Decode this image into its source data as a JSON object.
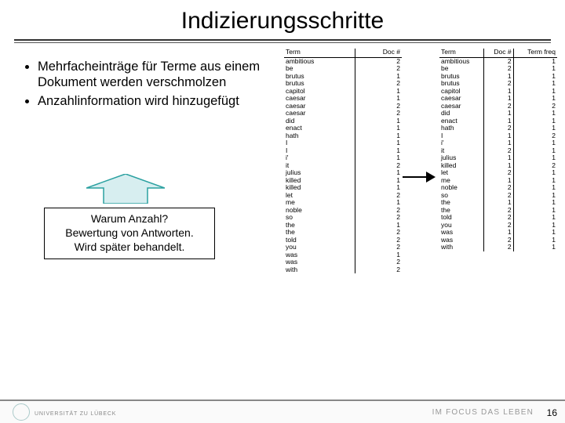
{
  "title": "Indizierungsschritte",
  "bullets": [
    "Mehrfacheinträge für Terme aus einem Dokument werden verschmolzen",
    "Anzahlinformation wird hinzugefügt"
  ],
  "callout": [
    "Warum Anzahl?",
    "Bewertung von Antworten.",
    "Wird später behandelt."
  ],
  "table1": {
    "headers": [
      "Term",
      "Doc #"
    ],
    "rows": [
      [
        "ambitious",
        2
      ],
      [
        "be",
        2
      ],
      [
        "brutus",
        1
      ],
      [
        "brutus",
        2
      ],
      [
        "capitol",
        1
      ],
      [
        "caesar",
        1
      ],
      [
        "caesar",
        2
      ],
      [
        "caesar",
        2
      ],
      [
        "did",
        1
      ],
      [
        "enact",
        1
      ],
      [
        "hath",
        1
      ],
      [
        "I",
        1
      ],
      [
        "I",
        1
      ],
      [
        "i'",
        1
      ],
      [
        "it",
        2
      ],
      [
        "julius",
        1
      ],
      [
        "killed",
        1
      ],
      [
        "killed",
        1
      ],
      [
        "let",
        2
      ],
      [
        "me",
        1
      ],
      [
        "noble",
        2
      ],
      [
        "so",
        2
      ],
      [
        "the",
        1
      ],
      [
        "the",
        2
      ],
      [
        "told",
        2
      ],
      [
        "you",
        2
      ],
      [
        "was",
        1
      ],
      [
        "was",
        2
      ],
      [
        "with",
        2
      ]
    ]
  },
  "table2": {
    "headers": [
      "Term",
      "Doc #",
      "Term freq"
    ],
    "rows": [
      [
        "ambitious",
        2,
        1
      ],
      [
        "be",
        2,
        1
      ],
      [
        "brutus",
        1,
        1
      ],
      [
        "brutus",
        2,
        1
      ],
      [
        "capitol",
        1,
        1
      ],
      [
        "caesar",
        1,
        1
      ],
      [
        "caesar",
        2,
        2
      ],
      [
        "did",
        1,
        1
      ],
      [
        "enact",
        1,
        1
      ],
      [
        "hath",
        2,
        1
      ],
      [
        "I",
        1,
        2
      ],
      [
        "i'",
        1,
        1
      ],
      [
        "it",
        2,
        1
      ],
      [
        "julius",
        1,
        1
      ],
      [
        "killed",
        1,
        2
      ],
      [
        "let",
        2,
        1
      ],
      [
        "me",
        1,
        1
      ],
      [
        "noble",
        2,
        1
      ],
      [
        "so",
        2,
        1
      ],
      [
        "the",
        1,
        1
      ],
      [
        "the",
        2,
        1
      ],
      [
        "told",
        2,
        1
      ],
      [
        "you",
        2,
        1
      ],
      [
        "was",
        1,
        1
      ],
      [
        "was",
        2,
        1
      ],
      [
        "with",
        2,
        1
      ]
    ]
  },
  "footer": {
    "uni": "UNIVERSITÄT ZU LÜBECK",
    "motto": "IM FOCUS DAS LEBEN",
    "page": "16"
  }
}
